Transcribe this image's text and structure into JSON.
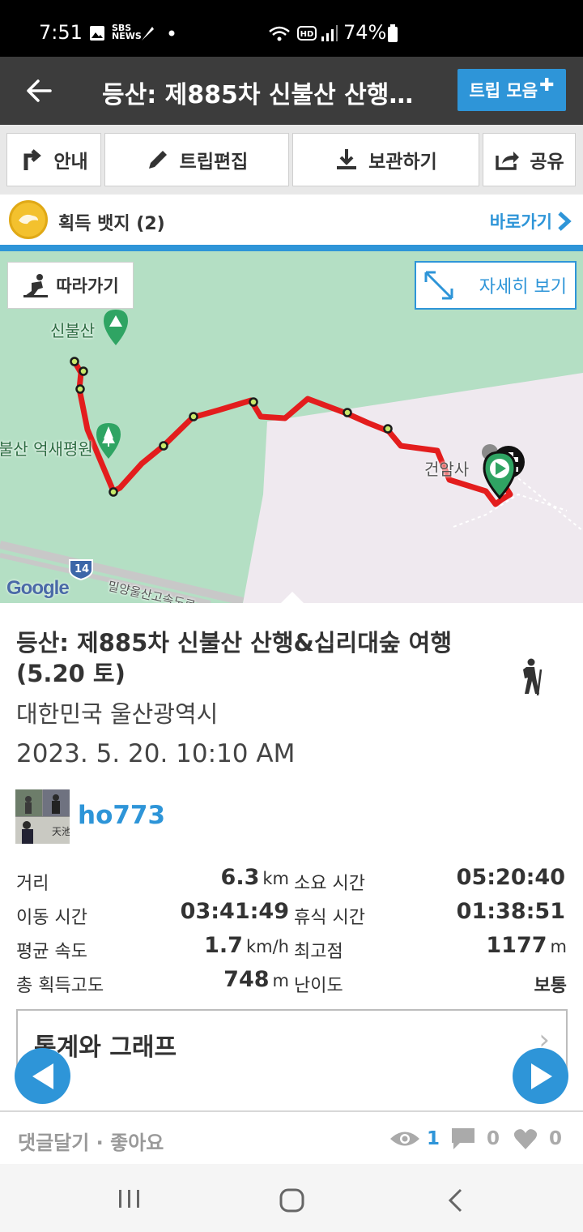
{
  "status_bar": {
    "time": "7:51",
    "battery": "74%",
    "icons": [
      "image-icon",
      "sbs-news-icon",
      "feather-icon",
      "dot-icon",
      "wifi-icon",
      "hd-icon",
      "signal-icon",
      "battery-icon"
    ]
  },
  "header": {
    "title": "등산: 제885차 신불산 산행…",
    "trip_button": "트립 모음"
  },
  "toolbar": {
    "guide": "안내",
    "edit": "트립편집",
    "save": "보관하기",
    "share": "공유"
  },
  "badge": {
    "label": "획득 뱃지 (2)",
    "link": "바로가기"
  },
  "map": {
    "follow_button": "따라가기",
    "detail_button": "자세히 보기",
    "labels": {
      "peak": "신불산",
      "plain": "불산 억새평원",
      "temple": "건암사",
      "road": "밀양울산고속도로",
      "route_num": "14"
    },
    "attribution": "Google"
  },
  "trip": {
    "title": "등산: 제885차 신불산 산행&십리대숲 여행(5.20 토)",
    "location": "대한민국 울산광역시",
    "datetime": "2023. 5. 20. 10:10 AM",
    "username": "ho773"
  },
  "stats": {
    "distance_label": "거리",
    "distance_value": "6.3",
    "distance_unit": "km",
    "duration_label": "소요 시간",
    "duration_value": "05:20:40",
    "moving_label": "이동 시간",
    "moving_value": "03:41:49",
    "rest_label": "휴식 시간",
    "rest_value": "01:38:51",
    "speed_label": "평균 속도",
    "speed_value": "1.7",
    "speed_unit": "km/h",
    "max_alt_label": "최고점",
    "max_alt_value": "1177",
    "max_alt_unit": "m",
    "gain_label": "총 획득고도",
    "gain_value": "748",
    "gain_unit": "m",
    "difficulty_label": "난이도",
    "difficulty_value": "보통"
  },
  "graph_section": {
    "title": "통계와 그래프"
  },
  "footer": {
    "comment_like": "댓글달기 · 좋아요",
    "views": "1",
    "comments": "0",
    "likes": "0"
  },
  "colors": {
    "accent": "#2e95d8",
    "route": "#e31d1d",
    "header": "#3c3c3c",
    "map_green": "#b4dfc4"
  }
}
